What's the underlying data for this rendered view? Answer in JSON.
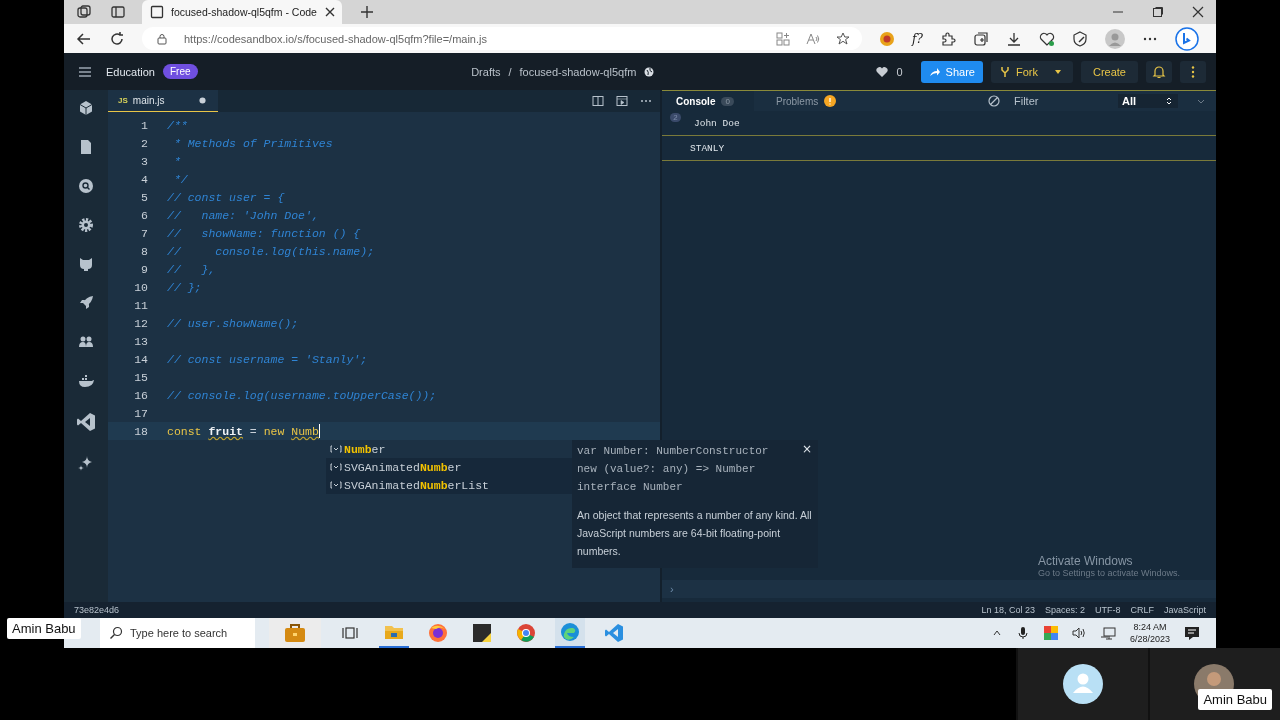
{
  "browser": {
    "tab_title": "focused-shadow-ql5qfm - Code",
    "url": "https://codesandbox.io/s/focused-shadow-ql5qfm?file=/main.js",
    "extension_label": "f?"
  },
  "header": {
    "workspace": "Education",
    "plan": "Free",
    "breadcrumb": [
      "Drafts",
      "/",
      "focused-shadow-ql5qfm"
    ],
    "likes": "0",
    "share": "Share",
    "fork": "Fork",
    "create": "Create"
  },
  "editor": {
    "tab": {
      "badge": "JS",
      "filename": "main.js",
      "modified": true
    },
    "lines": [
      {
        "number": "1",
        "current": false,
        "tokens": [
          {
            "kind": "comment",
            "text": "/**"
          }
        ]
      },
      {
        "number": "2",
        "current": false,
        "tokens": [
          {
            "kind": "comment",
            "text": " * Methods of Primitives"
          }
        ]
      },
      {
        "number": "3",
        "current": false,
        "tokens": [
          {
            "kind": "comment",
            "text": " *"
          }
        ]
      },
      {
        "number": "4",
        "current": false,
        "tokens": [
          {
            "kind": "comment",
            "text": " */"
          }
        ]
      },
      {
        "number": "5",
        "current": false,
        "tokens": [
          {
            "kind": "comment",
            "text": "// const user = {"
          }
        ]
      },
      {
        "number": "6",
        "current": false,
        "tokens": [
          {
            "kind": "comment",
            "text": "//   name: 'John Doe',"
          }
        ]
      },
      {
        "number": "7",
        "current": false,
        "tokens": [
          {
            "kind": "comment",
            "text": "//   showName: function () {"
          }
        ]
      },
      {
        "number": "8",
        "current": false,
        "tokens": [
          {
            "kind": "comment",
            "text": "//     console.log(this.name);"
          }
        ]
      },
      {
        "number": "9",
        "current": false,
        "tokens": [
          {
            "kind": "comment",
            "text": "//   },"
          }
        ]
      },
      {
        "number": "10",
        "current": false,
        "tokens": [
          {
            "kind": "comment",
            "text": "// };"
          }
        ]
      },
      {
        "number": "11",
        "current": false
      },
      {
        "number": "12",
        "current": false,
        "tokens": [
          {
            "kind": "comment",
            "text": "// user.showName();"
          }
        ]
      },
      {
        "number": "13",
        "current": false
      },
      {
        "number": "14",
        "current": false,
        "tokens": [
          {
            "kind": "comment",
            "text": "// const username = 'Stanly';"
          }
        ]
      },
      {
        "number": "15",
        "current": false
      },
      {
        "number": "16",
        "current": false,
        "tokens": [
          {
            "kind": "comment",
            "text": "// console.log(username.toUpperCase());"
          }
        ]
      },
      {
        "number": "17",
        "current": false
      },
      {
        "number": "18",
        "current": true,
        "tokens": [
          {
            "kind": "keyword",
            "text": "const "
          },
          {
            "kind": "variable",
            "text": "fruit"
          },
          {
            "kind": "plain",
            "text": " = "
          },
          {
            "kind": "keyword",
            "text": "new "
          },
          {
            "kind": "typed",
            "text": "Numb"
          }
        ]
      }
    ]
  },
  "autocomplete": {
    "suggestions": [
      {
        "parts": [
          {
            "text": "Numb",
            "match": true
          },
          {
            "text": "er",
            "match": false
          }
        ]
      },
      {
        "parts": [
          {
            "text": "SVGAnimated",
            "match": false
          },
          {
            "text": "Numb",
            "match": true
          },
          {
            "text": "er",
            "match": false
          }
        ]
      },
      {
        "parts": [
          {
            "text": "SVGAnimated",
            "match": false
          },
          {
            "text": "Numb",
            "match": true
          },
          {
            "text": "erList",
            "match": false
          }
        ]
      }
    ],
    "signature": [
      "var Number: NumberConstructor",
      "new (value?: any) => Number",
      "interface Number"
    ],
    "description": "An object that represents a number of any kind. All JavaScript numbers are 64-bit floating-point numbers.",
    "close": "×"
  },
  "console": {
    "tabs": [
      {
        "label": "Console",
        "badge": "0",
        "selected": true
      },
      {
        "label": "Problems",
        "selected": false
      }
    ],
    "filter_placeholder": "Filter",
    "level": "All",
    "entries": [
      {
        "count": "2",
        "text": "John Doe"
      },
      {
        "text": "STANLY"
      }
    ],
    "prompt": "›"
  },
  "status_bar": {
    "commit": "73e82e4d6",
    "items": [
      "Ln 18, Col 23",
      "Spaces: 2",
      "UTF-8",
      "CRLF",
      "JavaScript"
    ]
  },
  "activation_notice": {
    "title": "Activate Windows",
    "subtitle": "Go to Settings to activate Windows."
  },
  "taskbar": {
    "search_placeholder": "Type here to search",
    "time": "8:24 AM",
    "date": "6/28/2023"
  },
  "call": {
    "presenter_label": "Amin Babu",
    "participant_label": "Amin Babu"
  }
}
